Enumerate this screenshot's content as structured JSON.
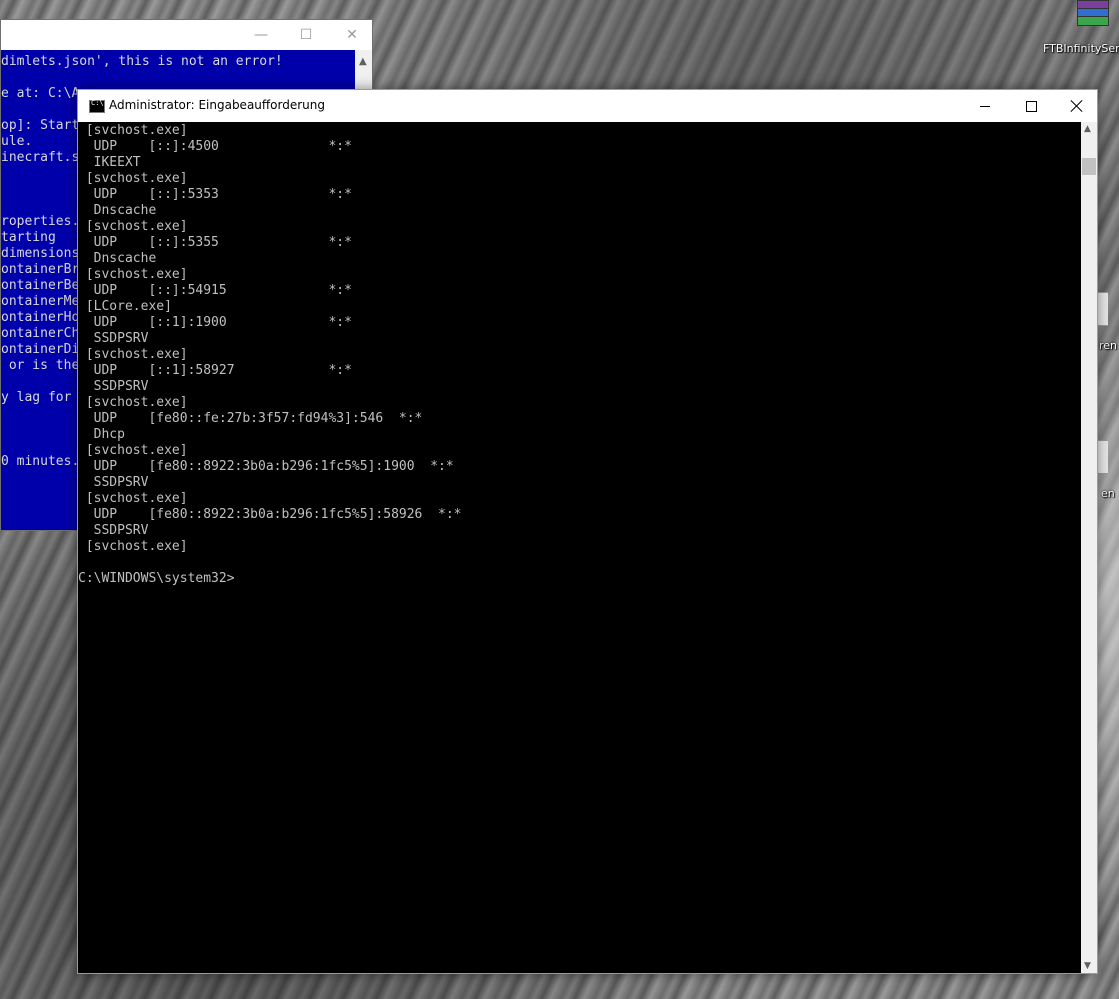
{
  "desktop": {
    "icons": [
      {
        "label": "FTBInfinityServ"
      },
      {
        "label": "ren"
      },
      {
        "label": "en"
      }
    ]
  },
  "background_window": {
    "lines": [
      "dimlets.json', this is not an error!",
      "",
      "e at: C:\\A",
      "",
      "op]: Start",
      "ule.",
      "inecraft.s",
      "",
      "",
      "",
      "roperties.",
      "tarting",
      "dimensions",
      "ontainerBr",
      "ontainerBe",
      "ontainerMe",
      "ontainerHo",
      "ontainerCh",
      "ontainerDi",
      " or is the",
      "",
      "y lag for",
      "",
      "",
      "",
      "0 minutes."
    ]
  },
  "cmd_window": {
    "title": "Administrator: Eingabeaufforderung",
    "icon_text": "C:\\",
    "console_text": " [svchost.exe]\n  UDP    [::]:4500              *:*\n  IKEEXT\n [svchost.exe]\n  UDP    [::]:5353              *:*\n  Dnscache\n [svchost.exe]\n  UDP    [::]:5355              *:*\n  Dnscache\n [svchost.exe]\n  UDP    [::]:54915             *:*\n [LCore.exe]\n  UDP    [::1]:1900             *:*\n  SSDPSRV\n [svchost.exe]\n  UDP    [::1]:58927            *:*\n  SSDPSRV\n [svchost.exe]\n  UDP    [fe80::fe:27b:3f57:fd94%3]:546  *:*\n  Dhcp\n [svchost.exe]\n  UDP    [fe80::8922:3b0a:b296:1fc5%5]:1900  *:*\n  SSDPSRV\n [svchost.exe]\n  UDP    [fe80::8922:3b0a:b296:1fc5%5]:58926  *:*\n  SSDPSRV\n [svchost.exe]\n\nC:\\WINDOWS\\system32>"
  }
}
